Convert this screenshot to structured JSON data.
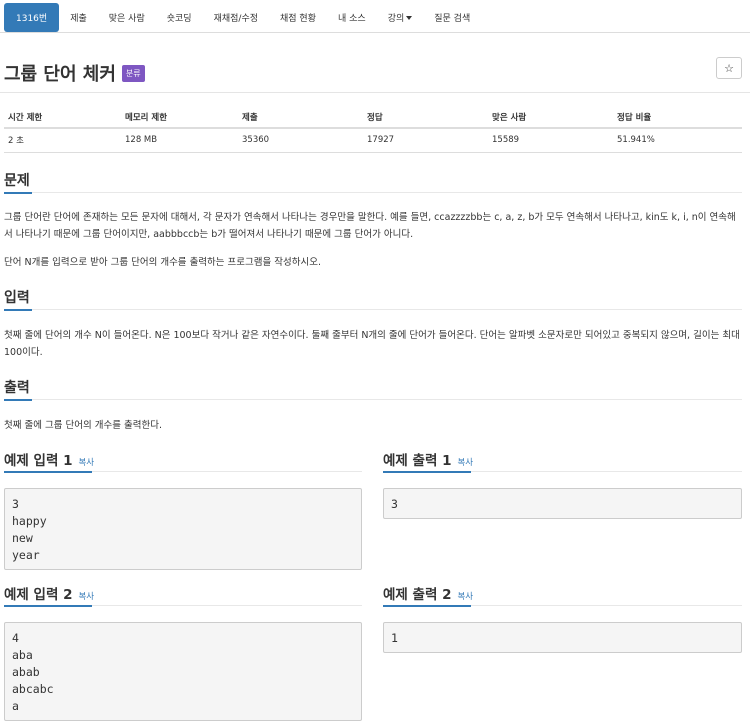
{
  "nav": {
    "tabs": [
      "1316번",
      "제출",
      "맞은 사람",
      "숏코딩",
      "재채점/수정",
      "채점 현황",
      "내 소스",
      "강의",
      "질문 검색"
    ]
  },
  "problem": {
    "title": "그룹 단어 체커",
    "category_badge": "분류",
    "star": "☆"
  },
  "info_table": {
    "headers": [
      "시간 제한",
      "메모리 제한",
      "제출",
      "정답",
      "맞은 사람",
      "정답 비율"
    ],
    "values": [
      "2 초",
      "128 MB",
      "35360",
      "17927",
      "15589",
      "51.941%"
    ]
  },
  "sections": {
    "problem_heading": "문제",
    "problem_text_1": "그룹 단어란 단어에 존재하는 모든 문자에 대해서, 각 문자가 연속해서 나타나는 경우만을 말한다. 예를 들면, ccazzzzbb는 c, a, z, b가 모두 연속해서 나타나고, kin도 k, i, n이 연속해서 나타나기 때문에 그룹 단어이지만, aabbbccb는 b가 떨어져서 나타나기 때문에 그룹 단어가 아니다.",
    "problem_text_2": "단어 N개를 입력으로 받아 그룹 단어의 개수를 출력하는 프로그램을 작성하시오.",
    "input_heading": "입력",
    "input_text": "첫째 줄에 단어의 개수 N이 들어온다. N은 100보다 작거나 같은 자연수이다. 둘째 줄부터 N개의 줄에 단어가 들어온다. 단어는 알파벳 소문자로만 되어있고 중복되지 않으며, 길이는 최대 100이다.",
    "output_heading": "출력",
    "output_text": "첫째 줄에 그룹 단어의 개수를 출력한다."
  },
  "examples": {
    "copy_label": "복사",
    "input1_heading": "예제 입력 1",
    "output1_heading": "예제 출력 1",
    "input2_heading": "예제 입력 2",
    "output2_heading": "예제 출력 2",
    "input1": "3\nhappy\nnew\nyear",
    "output1": "3",
    "input2": "4\naba\nabab\nabcabc\na",
    "output2": "1"
  }
}
